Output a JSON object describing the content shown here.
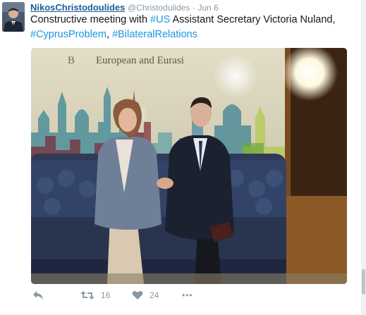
{
  "tweet": {
    "author_name": "NikosChristodoulides",
    "author_handle": "@Christodulides",
    "separator": "·",
    "timestamp": "Jun 6",
    "text_parts": {
      "p1": "Constructive meeting with ",
      "h1": "#US",
      "p2": " Assistant Secretary Victoria Nuland,",
      "h2": "#CyprusProblem",
      "p3": ", ",
      "h3": "#BilateralRelations"
    },
    "photo_sign": "European and Eurasi",
    "photo_sign_partial": "B",
    "actions": {
      "reply_icon": "reply-icon",
      "retweet_icon": "retweet-icon",
      "retweet_count": "16",
      "like_icon": "heart-icon",
      "like_count": "24",
      "more_icon": "more-icon",
      "more_label": "•••"
    },
    "colors": {
      "name": "#1b5d9a",
      "hashtag": "#1b95e0",
      "muted": "#8899a6"
    }
  }
}
